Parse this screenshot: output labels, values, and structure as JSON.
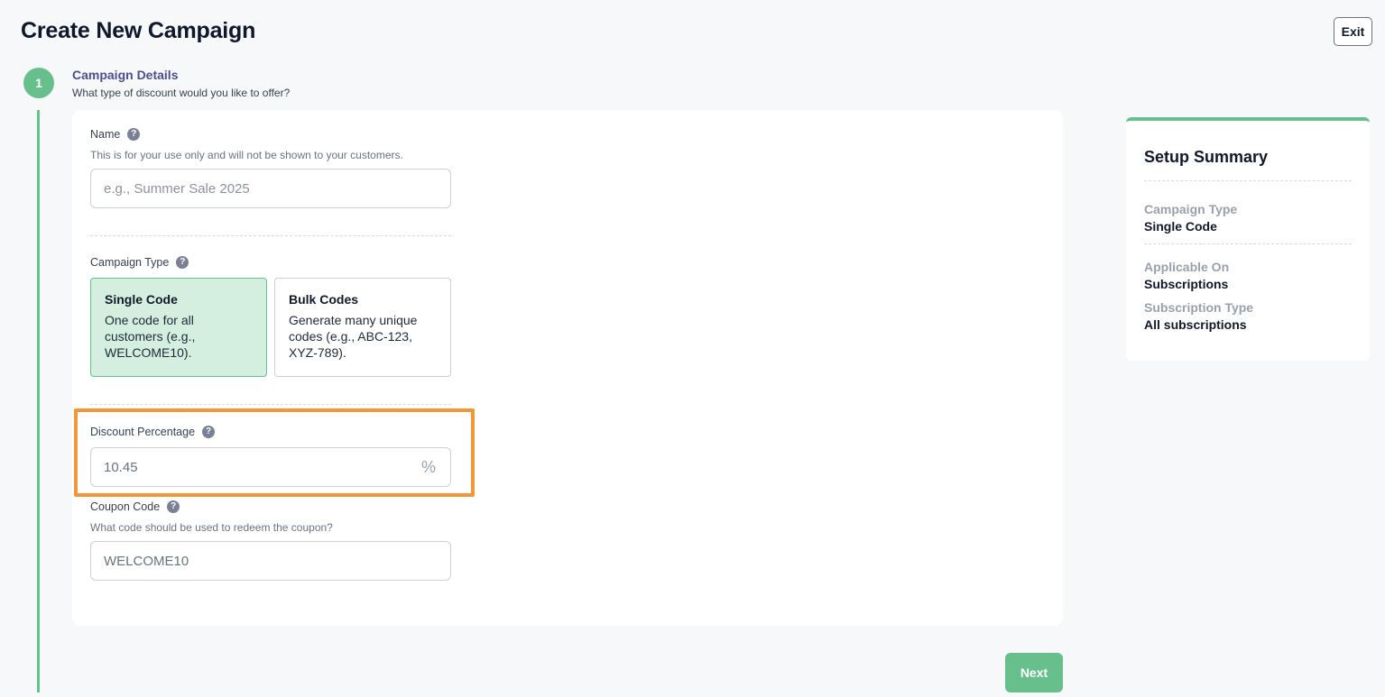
{
  "header": {
    "title": "Create New Campaign",
    "exit_label": "Exit"
  },
  "stepper": {
    "step_number": "1",
    "title": "Campaign Details",
    "subtitle": "What type of discount would you like to offer?"
  },
  "form": {
    "name": {
      "label": "Name",
      "hint": "This is for your use only and will not be shown to your customers.",
      "placeholder": "e.g., Summer Sale 2025",
      "value": ""
    },
    "campaign_type": {
      "label": "Campaign Type",
      "selected": "Single Code",
      "options": [
        {
          "title": "Single Code",
          "description": "One code for all customers (e.g., WELCOME10)."
        },
        {
          "title": "Bulk Codes",
          "description": "Generate many unique codes (e.g., ABC-123, XYZ-789)."
        }
      ]
    },
    "discount_percentage": {
      "label": "Discount Percentage",
      "value": "10.45",
      "suffix": "%"
    },
    "coupon_code": {
      "label": "Coupon Code",
      "hint": "What code should be used to redeem the coupon?",
      "value": "WELCOME10"
    },
    "help_glyph": "?"
  },
  "actions": {
    "next_label": "Next"
  },
  "summary": {
    "title": "Setup Summary",
    "items": [
      {
        "label": "Campaign Type",
        "value": "Single Code"
      },
      {
        "label": "Applicable On",
        "value": "Subscriptions"
      },
      {
        "label": "Subscription Type",
        "value": "All subscriptions"
      }
    ]
  },
  "colors": {
    "accent": "#67c08c",
    "selected_bg": "#d4efdf",
    "highlight": "#f2963a",
    "step_title": "#4b4f8c"
  },
  "icons": {
    "help": "help-circle-icon"
  }
}
